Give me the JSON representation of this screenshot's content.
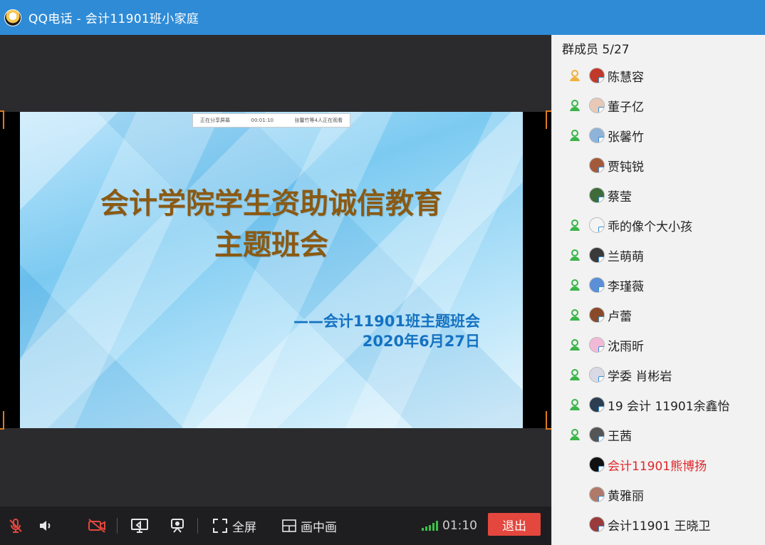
{
  "window": {
    "title": "QQ电话 - 会计11901班小家庭"
  },
  "share_bar": {
    "status": "正在分享屏幕",
    "timer": "00:01:10",
    "watchers": "张馨竹等4人正在观看"
  },
  "slide": {
    "title_line1": "会计学院学生资助诚信教育",
    "title_line2": "主题班会",
    "subtitle_line1": "——会计11901班主题班会",
    "subtitle_line2": "2020年6月27日"
  },
  "toolbar": {
    "fullscreen_label": "全屏",
    "pip_label": "画中画",
    "call_time": "01:10",
    "exit_label": "退出"
  },
  "members": {
    "header": "群成员 5/27",
    "list": [
      {
        "name": "陈慧容",
        "active": true,
        "icon_color": "#f0b23c",
        "avatar": "#c0392b",
        "red": false
      },
      {
        "name": "董子亿",
        "active": true,
        "icon_color": "#3bb54a",
        "avatar": "#e8c9b8",
        "red": false
      },
      {
        "name": "张馨竹",
        "active": true,
        "icon_color": "#3bb54a",
        "avatar": "#8fb3d9",
        "red": false
      },
      {
        "name": "贾钝锐",
        "active": false,
        "icon_color": "",
        "avatar": "#a35a3a",
        "red": false
      },
      {
        "name": "蔡莹",
        "active": false,
        "icon_color": "",
        "avatar": "#3f6b3a",
        "red": false
      },
      {
        "name": "乖的像个大小孩",
        "active": true,
        "icon_color": "#3bb54a",
        "avatar": "#f4f4f4",
        "red": false
      },
      {
        "name": "兰萌萌",
        "active": true,
        "icon_color": "#3bb54a",
        "avatar": "#3a3a3a",
        "red": false
      },
      {
        "name": "李瑾薇",
        "active": true,
        "icon_color": "#3bb54a",
        "avatar": "#5b8fd6",
        "red": false
      },
      {
        "name": "卢蕾",
        "active": true,
        "icon_color": "#3bb54a",
        "avatar": "#8a4a2a",
        "red": false
      },
      {
        "name": "沈雨昕",
        "active": true,
        "icon_color": "#3bb54a",
        "avatar": "#f2b9d6",
        "red": false
      },
      {
        "name": "学委 肖彬岩",
        "active": true,
        "icon_color": "#3bb54a",
        "avatar": "#d9d9e6",
        "red": false
      },
      {
        "name": "19 会计 11901余鑫怡",
        "active": true,
        "icon_color": "#3bb54a",
        "avatar": "#2c3e50",
        "red": false
      },
      {
        "name": "王茜",
        "active": true,
        "icon_color": "#3bb54a",
        "avatar": "#555555",
        "red": false
      },
      {
        "name": "会计11901熊博扬",
        "active": false,
        "icon_color": "",
        "avatar": "#111111",
        "red": true
      },
      {
        "name": "黄雅丽",
        "active": false,
        "icon_color": "",
        "avatar": "#b07a6a",
        "red": false
      },
      {
        "name": "会计11901 王晓卫",
        "active": false,
        "icon_color": "",
        "avatar": "#9a3b3b",
        "red": false
      }
    ]
  }
}
